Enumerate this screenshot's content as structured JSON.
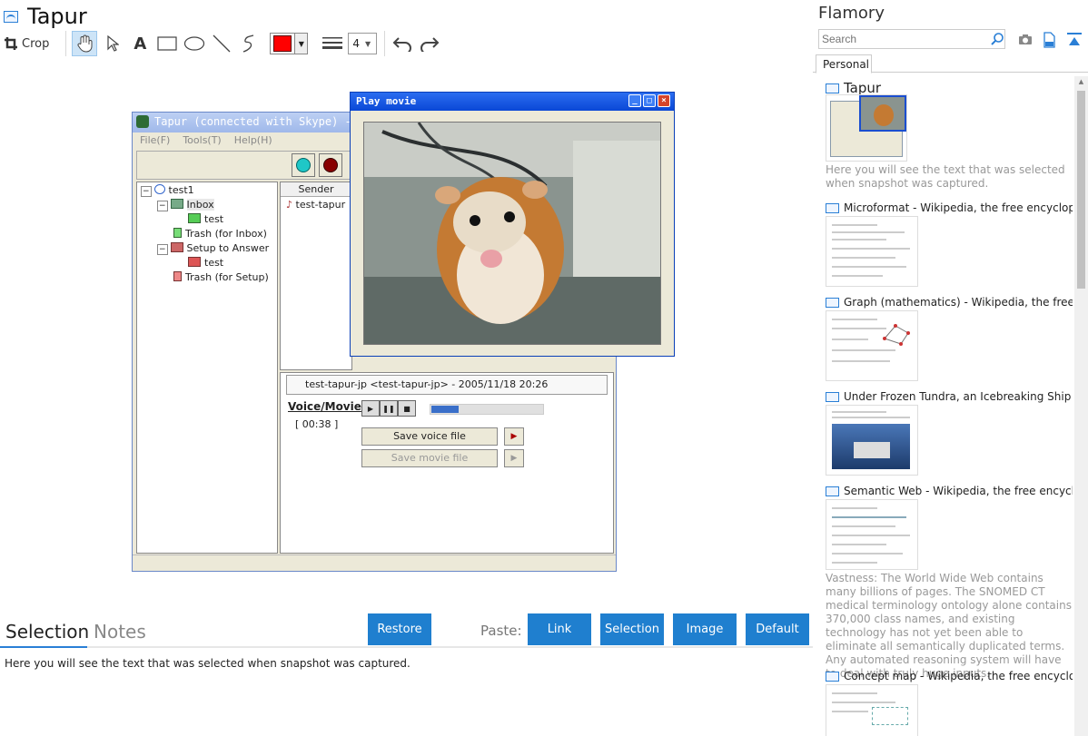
{
  "window": {
    "title": "Tapur"
  },
  "toolbar": {
    "crop_label": "Crop",
    "line_width": "4",
    "color": "#ff0000"
  },
  "screenshot": {
    "main_window_title": "Tapur (connected with Skype) - tes",
    "menu": [
      "File(F)",
      "Tools(T)",
      "Help(H)"
    ],
    "tree": [
      "test1",
      "Inbox",
      "test",
      "Trash (for Inbox)",
      "Setup to Answer",
      "test",
      "Trash (for Setup)"
    ],
    "list_header": "Sender",
    "list_item": "test-tapur",
    "detail_header": "test-tapur-jp <test-tapur-jp> - 2005/11/18 20:26",
    "voice_label": "Voice/Movie:",
    "voice_time": "[ 00:38 ]",
    "save_voice": "Save voice file",
    "save_movie": "Save movie file",
    "movie_title": "Play movie"
  },
  "bottom": {
    "tab_selection": "Selection",
    "tab_notes": "Notes",
    "restore": "Restore",
    "paste_label": "Paste:",
    "paste_link": "Link",
    "paste_selection": "Selection",
    "paste_image": "Image",
    "paste_default": "Default",
    "selected_text": "Here you will see the text that was selected when snapshot was captured."
  },
  "sidebar": {
    "app_name": "Flamory",
    "search_placeholder": "Search",
    "tab_personal": "Personal",
    "items": [
      {
        "title": "Tapur",
        "snippet": "Here you will see the text that was selected when snapshot was captured."
      },
      {
        "title": "Microformat - Wikipedia, the free encyclopedia"
      },
      {
        "title": "Graph (mathematics) - Wikipedia, the free ency"
      },
      {
        "title": "Under Frozen Tundra, an Icebreaking Ship Unco"
      },
      {
        "title": "Semantic Web - Wikipedia, the free encycloped",
        "snippet": "Vastness: The World Wide Web contains many billions of pages. The SNOMED CT medical terminology ontology alone contains 370,000 class names, and existing technology has not yet been able to eliminate all semantically duplicated terms. Any automated reasoning system will have to deal with truly huge inputs."
      },
      {
        "title": "Concept map - Wikipedia, the free encyclopedi"
      }
    ]
  }
}
